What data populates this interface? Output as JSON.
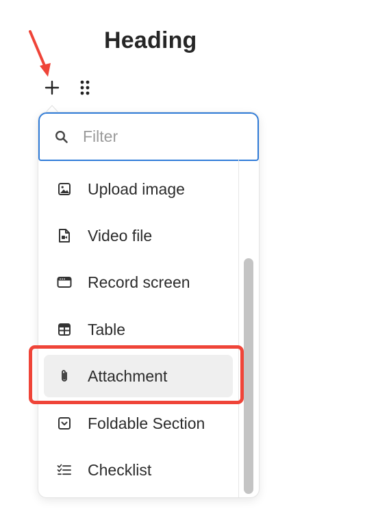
{
  "editor": {
    "heading": "Heading"
  },
  "toolbar": {
    "add_icon": "plus-icon",
    "drag_icon": "drag-handle-icon"
  },
  "menu": {
    "filter": {
      "placeholder": "Filter",
      "value": "",
      "icon": "search-icon"
    },
    "items": [
      {
        "label": "Upload image",
        "icon": "image-icon"
      },
      {
        "label": "Video file",
        "icon": "video-file-icon"
      },
      {
        "label": "Record screen",
        "icon": "record-screen-icon"
      },
      {
        "label": "Table",
        "icon": "table-icon"
      },
      {
        "label": "Attachment",
        "icon": "paperclip-icon",
        "highlighted": true
      },
      {
        "label": "Foldable Section",
        "icon": "foldable-section-icon"
      },
      {
        "label": "Checklist",
        "icon": "checklist-icon"
      }
    ]
  },
  "annotations": {
    "arrow_color": "#ef4438",
    "highlight_color": "#ef4438"
  },
  "colors": {
    "focus_border": "#2f7bd8",
    "hover_bg": "#efefef",
    "scroll_thumb": "#c4c4c4"
  }
}
